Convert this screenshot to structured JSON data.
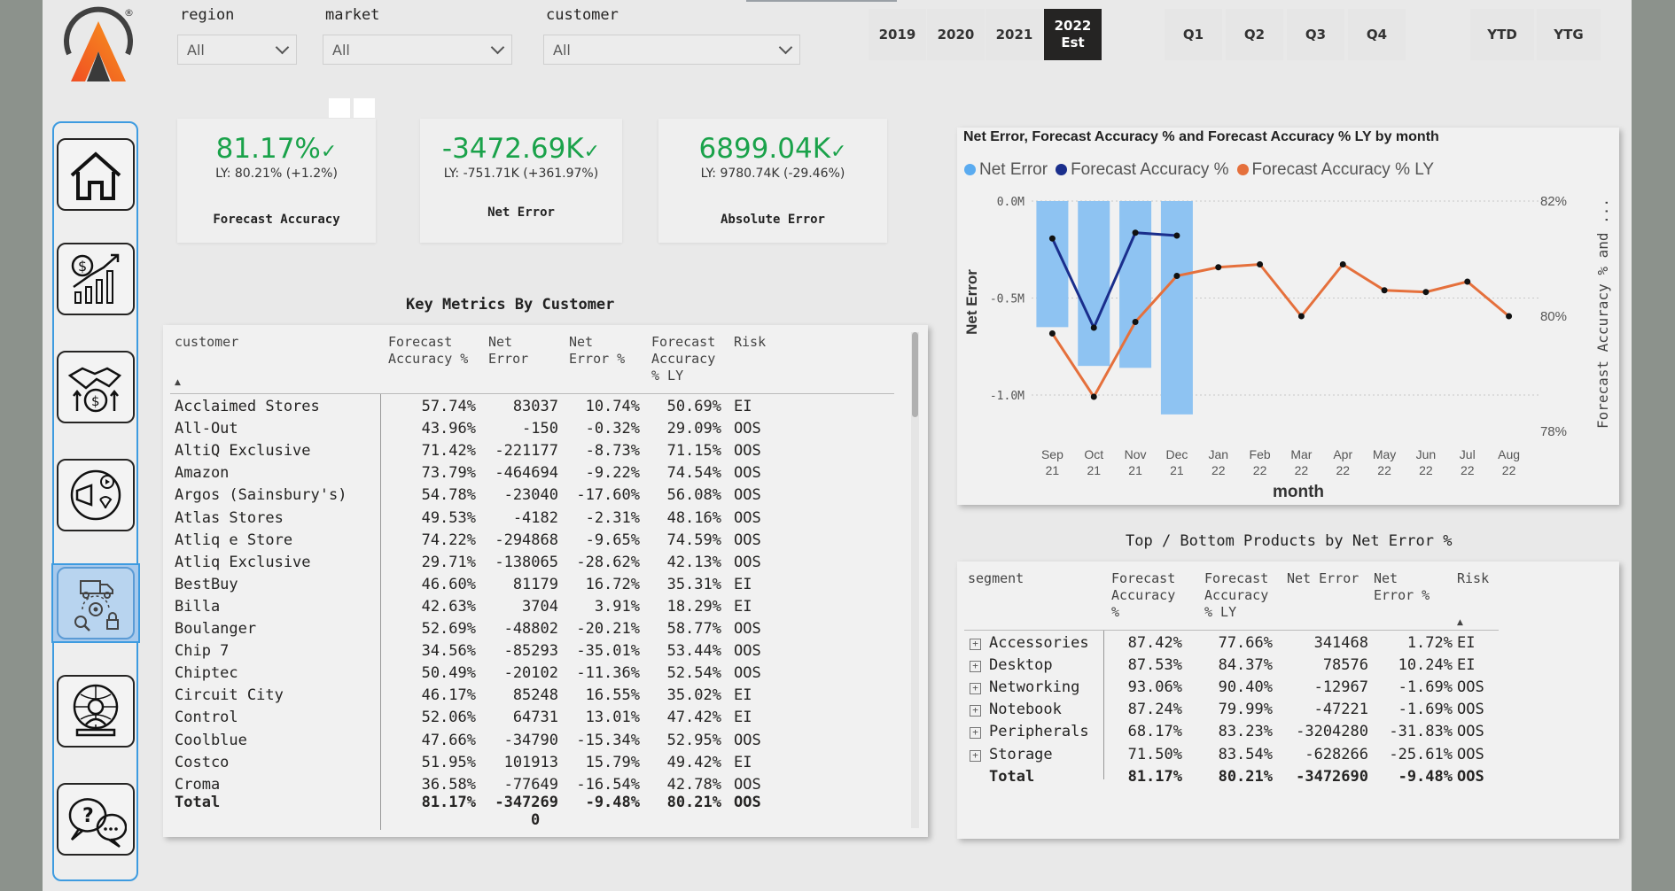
{
  "filters": [
    {
      "label": "region",
      "value": "All"
    },
    {
      "label": "market",
      "value": "All"
    },
    {
      "label": "customer",
      "value": "All"
    }
  ],
  "years": [
    {
      "label": "2019"
    },
    {
      "label": "2020"
    },
    {
      "label": "2021"
    },
    {
      "label": "2022",
      "sub": "Est",
      "selected": true
    }
  ],
  "quarters": [
    "Q1",
    "Q2",
    "Q3",
    "Q4"
  ],
  "ytd": [
    "YTD",
    "YTG"
  ],
  "nav": [
    {
      "name": "home",
      "active": false
    },
    {
      "name": "finance",
      "active": false
    },
    {
      "name": "deals",
      "active": false
    },
    {
      "name": "marketing",
      "active": false
    },
    {
      "name": "supply-chain",
      "active": true
    },
    {
      "name": "executive",
      "active": false
    },
    {
      "name": "support",
      "active": false
    }
  ],
  "kpis": [
    {
      "value": "81.17%",
      "check": "✓",
      "ly": "LY: 80.21% (+1.2%)",
      "label": "Forecast Accuracy"
    },
    {
      "value": "-3472.69K",
      "check": "✓",
      "ly": "LY: -751.71K (+361.97%)",
      "label": "Net Error"
    },
    {
      "value": "6899.04K",
      "check": "✓",
      "ly": "LY: 9780.74K (-29.46%)",
      "label": "Absolute Error"
    }
  ],
  "customer_table": {
    "title": "Key Metrics By Customer",
    "headers": [
      "customer",
      "Forecast\nAccuracy %",
      "Net\nError",
      "Net\nError %",
      "Forecast\nAccuracy\n% LY",
      "Risk"
    ],
    "sort_indicator": "▲",
    "rows": [
      [
        "Acclaimed Stores",
        "57.74%",
        "83037",
        "10.74%",
        "50.69%",
        "EI"
      ],
      [
        "All-Out",
        "43.96%",
        "-150",
        "-0.32%",
        "29.09%",
        "OOS"
      ],
      [
        "AltiQ Exclusive",
        "71.42%",
        "-221177",
        "-8.73%",
        "71.15%",
        "OOS"
      ],
      [
        "Amazon",
        "73.79%",
        "-464694",
        "-9.22%",
        "74.54%",
        "OOS"
      ],
      [
        "Argos (Sainsbury's)",
        "54.78%",
        "-23040",
        "-17.60%",
        "56.08%",
        "OOS"
      ],
      [
        "Atlas Stores",
        "49.53%",
        "-4182",
        "-2.31%",
        "48.16%",
        "OOS"
      ],
      [
        "Atliq e Store",
        "74.22%",
        "-294868",
        "-9.65%",
        "74.59%",
        "OOS"
      ],
      [
        "Atliq Exclusive",
        "29.71%",
        "-138065",
        "-28.62%",
        "42.13%",
        "OOS"
      ],
      [
        "BestBuy",
        "46.60%",
        "81179",
        "16.72%",
        "35.31%",
        "EI"
      ],
      [
        "Billa",
        "42.63%",
        "3704",
        "3.91%",
        "18.29%",
        "EI"
      ],
      [
        "Boulanger",
        "52.69%",
        "-48802",
        "-20.21%",
        "58.77%",
        "OOS"
      ],
      [
        "Chip 7",
        "34.56%",
        "-85293",
        "-35.01%",
        "53.44%",
        "OOS"
      ],
      [
        "Chiptec",
        "50.49%",
        "-20102",
        "-11.36%",
        "52.54%",
        "OOS"
      ],
      [
        "Circuit City",
        "46.17%",
        "85248",
        "16.55%",
        "35.02%",
        "EI"
      ],
      [
        "Control",
        "52.06%",
        "64731",
        "13.01%",
        "47.42%",
        "EI"
      ],
      [
        "Coolblue",
        "47.66%",
        "-34790",
        "-15.34%",
        "52.95%",
        "OOS"
      ],
      [
        "Costco",
        "51.95%",
        "101913",
        "15.79%",
        "49.42%",
        "EI"
      ],
      [
        "Croma",
        "36.58%",
        "-77649",
        "-16.54%",
        "42.78%",
        "OOS"
      ]
    ],
    "total": [
      "Total",
      "81.17%",
      "-347269",
      "-9.48%",
      "80.21%",
      "OOS"
    ],
    "total_wrap": "0"
  },
  "chart": {
    "title": "Net Error, Forecast Accuracy % and Forecast Accuracy % LY by month",
    "legend": [
      {
        "name": "Net Error",
        "color": "#5aabf0"
      },
      {
        "name": "Forecast Accuracy %",
        "color": "#1a2e8c"
      },
      {
        "name": "Forecast Accuracy % LY",
        "color": "#e5703c"
      }
    ],
    "left_ticks": [
      "0.0M",
      "-0.5M",
      "-1.0M"
    ],
    "right_ticks": [
      "82%",
      "80%",
      "78%"
    ],
    "ylabel_left": "Net Error",
    "ylabel_right": "Forecast Accuracy % and ...",
    "xlabel": "month",
    "months": [
      [
        "Sep",
        "21"
      ],
      [
        "Oct",
        "21"
      ],
      [
        "Nov",
        "21"
      ],
      [
        "Dec",
        "21"
      ],
      [
        "Jan",
        "22"
      ],
      [
        "Feb",
        "22"
      ],
      [
        "Mar",
        "22"
      ],
      [
        "Apr",
        "22"
      ],
      [
        "May",
        "22"
      ],
      [
        "Jun",
        "22"
      ],
      [
        "Jul",
        "22"
      ],
      [
        "Aug",
        "22"
      ]
    ]
  },
  "chart_data": {
    "type": "bar",
    "title": "Net Error, Forecast Accuracy % and Forecast Accuracy % LY by month",
    "xlabel": "month",
    "ylabel": "Net Error",
    "y2label": "Forecast Accuracy % and ...",
    "categories": [
      "Sep 21",
      "Oct 21",
      "Nov 21",
      "Dec 21",
      "Jan 22",
      "Feb 22",
      "Mar 22",
      "Apr 22",
      "May 22",
      "Jun 22",
      "Jul 22",
      "Aug 22"
    ],
    "ylim": [
      -1.1,
      0.0
    ],
    "y2lim": [
      78,
      82
    ],
    "series": [
      {
        "name": "Net Error",
        "type": "bar",
        "axis": "left",
        "unit": "M",
        "values": [
          -0.65,
          -0.85,
          -0.86,
          -1.1,
          null,
          null,
          null,
          null,
          null,
          null,
          null,
          null
        ]
      },
      {
        "name": "Forecast Accuracy %",
        "type": "line",
        "axis": "right",
        "unit": "%",
        "values": [
          81.35,
          79.8,
          81.45,
          81.4,
          null,
          null,
          null,
          null,
          null,
          null,
          null,
          null
        ]
      },
      {
        "name": "Forecast Accuracy % LY",
        "type": "line",
        "axis": "right",
        "unit": "%",
        "values": [
          79.7,
          78.6,
          79.9,
          80.7,
          80.85,
          80.9,
          80.0,
          80.9,
          80.45,
          80.42,
          80.6,
          80.0
        ]
      }
    ]
  },
  "products_table": {
    "title": "Top / Bottom Products by Net Error %",
    "headers": [
      "segment",
      "Forecast\nAccuracy\n%",
      "Forecast\nAccuracy\n% LY",
      "Net Error",
      "Net\nError %",
      "Risk"
    ],
    "sort_indicator": "▲",
    "expand_glyph": "+",
    "rows": [
      [
        "Accessories",
        "87.42%",
        "77.66%",
        "341468",
        "1.72%",
        "EI"
      ],
      [
        "Desktop",
        "87.53%",
        "84.37%",
        "78576",
        "10.24%",
        "EI"
      ],
      [
        "Networking",
        "93.06%",
        "90.40%",
        "-12967",
        "-1.69%",
        "OOS"
      ],
      [
        "Notebook",
        "87.24%",
        "79.99%",
        "-47221",
        "-1.69%",
        "OOS"
      ],
      [
        "Peripherals",
        "68.17%",
        "83.23%",
        "-3204280",
        "-31.83%",
        "OOS"
      ],
      [
        "Storage",
        "71.50%",
        "83.54%",
        "-628266",
        "-25.61%",
        "OOS"
      ]
    ],
    "total": [
      "Total",
      "81.17%",
      "80.21%",
      "-3472690",
      "-9.48%",
      "OOS"
    ]
  },
  "logo": {
    "trademark": "®",
    "colors": [
      "#f04e23",
      "#f7941d",
      "#404040"
    ]
  }
}
